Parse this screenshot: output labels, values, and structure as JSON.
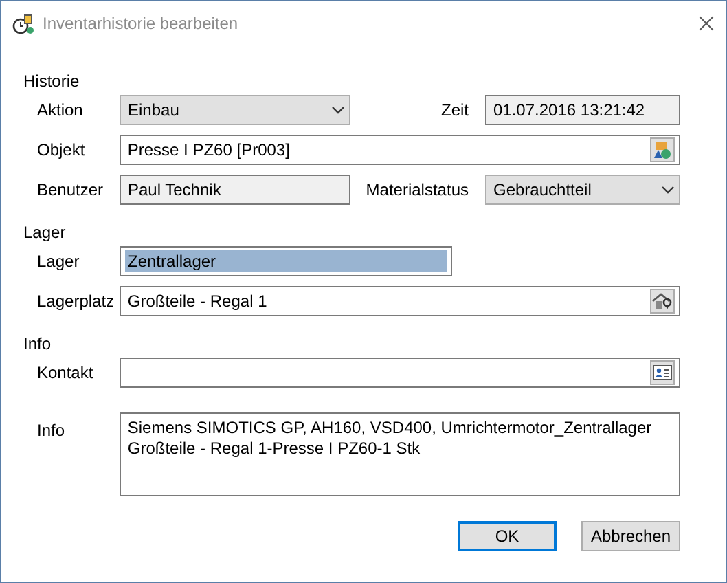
{
  "window": {
    "title": "Inventarhistorie bearbeiten"
  },
  "sections": [
    {
      "title": "Historie",
      "rows": [
        {
          "label": "Aktion",
          "field": {
            "kind": "combo",
            "value": "Einbau"
          },
          "side_label": "Zeit",
          "side_field": {
            "kind": "readonly",
            "value": "01.07.2016 13:21:42"
          }
        },
        {
          "label": "Objekt",
          "field": {
            "kind": "object",
            "value": "Presse I PZ60 [Pr003]"
          }
        },
        {
          "label": "Benutzer",
          "field": {
            "kind": "readonly",
            "value": "Paul Technik"
          },
          "side_label": "Materialstatus",
          "side_field": {
            "kind": "combo",
            "value": "Gebrauchtteil"
          }
        }
      ]
    },
    {
      "title": "Lager",
      "rows": [
        {
          "label": "Lager",
          "field": {
            "kind": "text",
            "value": "Zentrallager",
            "highlighted": true
          }
        },
        {
          "label": "Lagerplatz",
          "field": {
            "kind": "location",
            "value": "Großteile - Regal 1"
          }
        }
      ]
    },
    {
      "title": "Info",
      "rows": [
        {
          "label": "Kontakt",
          "field": {
            "kind": "contact"
          }
        },
        {
          "label": "Info",
          "field": {
            "kind": "memo",
            "lines": [
              "Siemens SIMOTICS GP, AH160, VSD400, Umrichtermotor_Zentrallager",
              "Großteile - Regal 1-Presse I PZ60-1 Stk"
            ]
          }
        }
      ]
    }
  ],
  "buttons": [
    {
      "label": "OK",
      "default": true
    },
    {
      "label": "Abbrechen",
      "default": false
    }
  ]
}
